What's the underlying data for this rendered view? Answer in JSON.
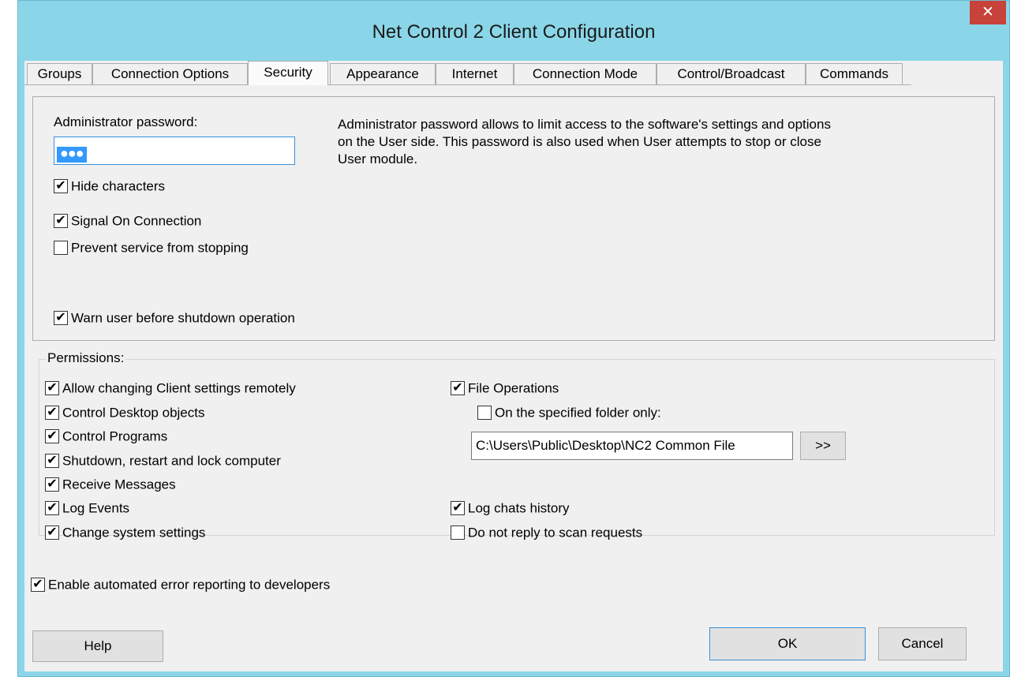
{
  "window": {
    "title": "Net Control 2 Client Configuration",
    "close_label": "✕"
  },
  "tabs": [
    {
      "label": "Groups"
    },
    {
      "label": "Connection Options"
    },
    {
      "label": "Security"
    },
    {
      "label": "Appearance"
    },
    {
      "label": "Internet"
    },
    {
      "label": "Connection Mode"
    },
    {
      "label": "Control/Broadcast"
    },
    {
      "label": "Commands"
    }
  ],
  "security": {
    "admin_password_label": "Administrator password:",
    "admin_password_value": "●●●",
    "description": "Administrator password allows to limit access to the software's settings and options on the User side. This password is also used when User attempts to stop or close User module.",
    "hide_characters": {
      "label": "Hide characters",
      "checked": true
    },
    "signal_on_connection": {
      "label": "Signal On Connection",
      "checked": true
    },
    "prevent_service_stopping": {
      "label": "Prevent service from stopping",
      "checked": false
    },
    "warn_shutdown": {
      "label": "Warn user before shutdown operation",
      "checked": true
    }
  },
  "permissions": {
    "title": "Permissions:",
    "left": [
      {
        "label": "Allow changing Client settings remotely",
        "checked": true
      },
      {
        "label": "Control Desktop objects",
        "checked": true
      },
      {
        "label": "Control Programs",
        "checked": true
      },
      {
        "label": "Shutdown, restart and lock computer",
        "checked": true
      },
      {
        "label": "Receive Messages",
        "checked": true
      },
      {
        "label": "Log Events",
        "checked": true
      },
      {
        "label": "Change system settings",
        "checked": true
      }
    ],
    "file_operations": {
      "label": "File Operations",
      "checked": true
    },
    "specified_folder_only": {
      "label": "On the specified folder only:",
      "checked": false
    },
    "folder_path": "C:\\Users\\Public\\Desktop\\NC2 Common File",
    "browse_label": ">>",
    "log_chats": {
      "label": "Log chats history",
      "checked": true
    },
    "no_reply_scan": {
      "label": "Do not reply to scan requests",
      "checked": false
    }
  },
  "error_reporting": {
    "label": "Enable automated error reporting to developers",
    "checked": true
  },
  "buttons": {
    "help": "Help",
    "ok": "OK",
    "cancel": "Cancel"
  },
  "colors": {
    "titlebar": "#8ad6e8",
    "close": "#c7423a",
    "dialog": "#f0f0f0",
    "selection": "#3399ff"
  }
}
